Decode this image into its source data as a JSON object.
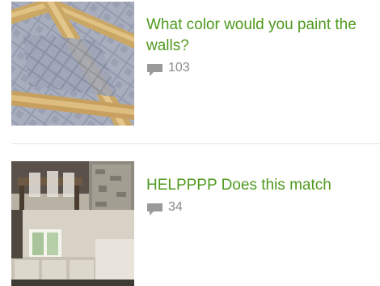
{
  "items": [
    {
      "title": "What color would you paint the walls?",
      "comment_count": "103",
      "thumbnail_icon": "tiled-floor-image"
    },
    {
      "title": "HELPPPP Does this match",
      "comment_count": "34",
      "thumbnail_icon": "kitchen-room-image"
    }
  ],
  "colors": {
    "title_link": "#4f9a1f",
    "meta_text": "#8a8a8a",
    "divider": "#e2e2e2"
  }
}
